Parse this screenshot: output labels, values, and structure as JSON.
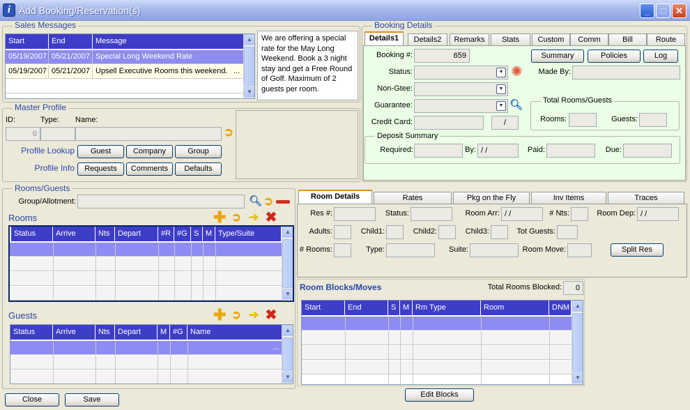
{
  "window": {
    "title": "Add Booking/Reservation(s)"
  },
  "icons": {
    "app": "i-icon",
    "search": "magnifier-icon",
    "go": "arrow-go-icon",
    "add": "plus-icon",
    "remove": "minus-icon",
    "next": "yellow-arrow-icon",
    "delete": "red-x-icon",
    "required": "asterisk-icon"
  },
  "sales": {
    "legend": "Sales Messages",
    "columns": [
      "Start",
      "End",
      "Message"
    ],
    "rows": [
      {
        "start": "05/19/2007",
        "end": "05/21/2007",
        "message": "Special Long Weekend Rate"
      },
      {
        "start": "05/19/2007",
        "end": "05/21/2007",
        "message": "Upsell Executive Rooms this weekend."
      }
    ],
    "detail": "We are offering a special rate for the May Long Weekend. Book a 3 night stay and get a Free Round of Golf. Maximum of 2 guests per room.",
    "ellipsis": "..."
  },
  "master": {
    "legend": "Master Profile",
    "id_label": "ID:",
    "type_label": "Type:",
    "name_label": "Name:",
    "id_value": "0",
    "lookup_label": "Profile Lookup",
    "guest": "Guest",
    "company": "Company",
    "group": "Group",
    "info_label": "Profile Info",
    "requests": "Requests",
    "comments": "Comments",
    "defaults": "Defaults"
  },
  "booking": {
    "legend": "Booking Details",
    "tabs": [
      "Details1",
      "Details2",
      "Remarks",
      "Stats",
      "Custom",
      "Comm",
      "Bill",
      "Route"
    ],
    "booking_no_label": "Booking #:",
    "booking_no": "659",
    "status_label": "Status:",
    "nongtee_label": "Non-Gtee:",
    "guarantee_label": "Guarantee:",
    "credit_label": "Credit Card:",
    "credit_exp": "/",
    "summary": "Summary",
    "policies": "Policies",
    "log": "Log",
    "made_by_label": "Made By:",
    "totals_legend": "Total Rooms/Guests",
    "rooms_label": "Rooms:",
    "guests_label": "Guests:",
    "deposit_legend": "Deposit Summary",
    "required_label": "Required:",
    "by_label": "By:",
    "by_value": "/ /",
    "paid_label": "Paid:",
    "due_label": "Due:"
  },
  "rg": {
    "legend": "Rooms/Guests",
    "group_label": "Group/Allotment:",
    "rooms_title": "Rooms",
    "rooms_columns": [
      "Status",
      "Arrive",
      "Nts",
      "Depart",
      "#R",
      "#G",
      "S",
      "M",
      "Type/Suite"
    ],
    "guests_title": "Guests",
    "guests_columns": [
      "Status",
      "Arrive",
      "Nts",
      "Depart",
      "M",
      "#G",
      "Name"
    ],
    "guests_ellipsis": "..."
  },
  "room_details": {
    "tabs": [
      "Room Details",
      "Rates",
      "Pkg on the Fly",
      "Inv Items",
      "Traces"
    ],
    "res_label": "Res #:",
    "status_label": "Status:",
    "arr_label": "Room Arr:",
    "arr_value": "/ /",
    "nts_label": "# Nts:",
    "dep_label": "Room Dep:",
    "dep_value": "/ /",
    "adults_label": "Adults:",
    "child1_label": "Child1:",
    "child2_label": "Child2:",
    "child3_label": "Child3:",
    "tot_label": "Tot Guests:",
    "rooms_label": "# Rooms:",
    "type_label": "Type:",
    "suite_label": "Suite:",
    "move_label": "Room Move:",
    "split": "Split Res"
  },
  "blocks": {
    "title": "Room Blocks/Moves",
    "total_label": "Total Rooms Blocked:",
    "total_value": "0",
    "columns": [
      "Start",
      "End",
      "S",
      "M",
      "Rm Type",
      "Room",
      "DNM"
    ],
    "edit": "Edit Blocks"
  },
  "footer": {
    "close": "Close",
    "save": "Save"
  }
}
